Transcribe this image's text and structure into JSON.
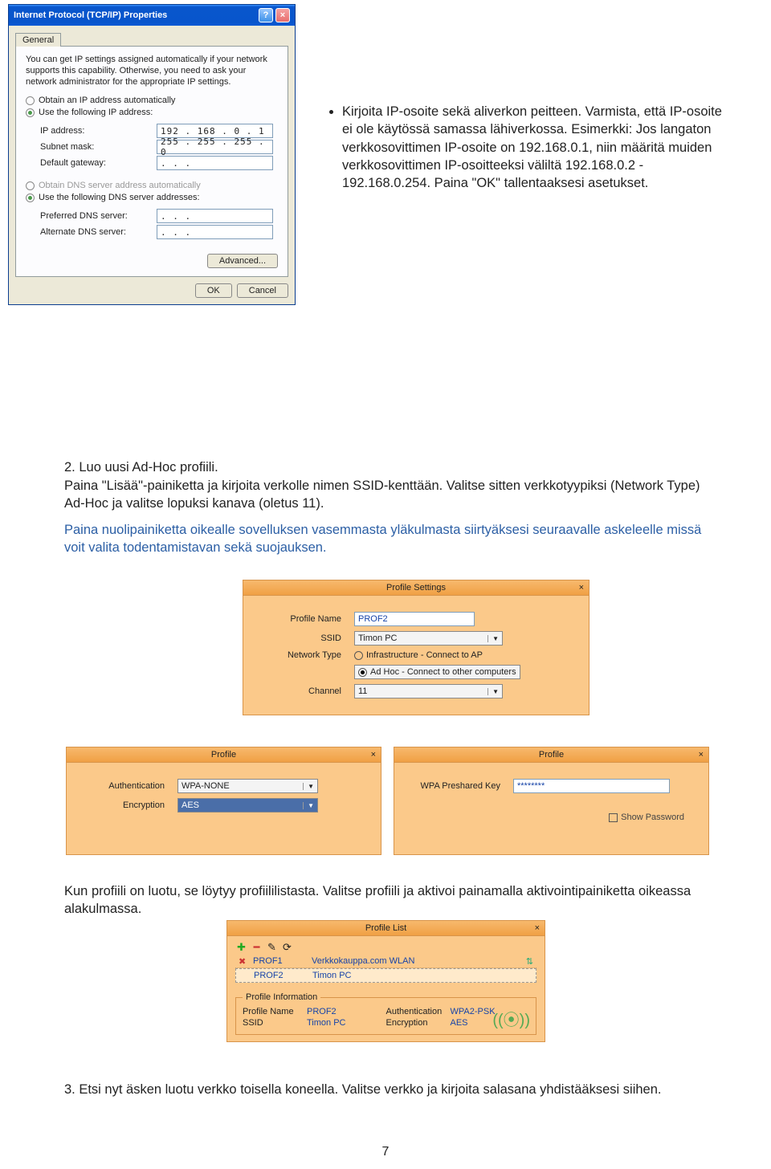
{
  "tcpip": {
    "title": "Internet Protocol (TCP/IP) Properties",
    "tab": "General",
    "intro": "You can get IP settings assigned automatically if your network supports this capability. Otherwise, you need to ask your network administrator for the appropriate IP settings.",
    "opt_auto_ip": "Obtain an IP address automatically",
    "opt_use_ip": "Use the following IP address:",
    "ip_label": "IP address:",
    "ip_value": "192 . 168 .   0 .   1",
    "subnet_label": "Subnet mask:",
    "subnet_value": "255 . 255 . 255 .   0",
    "gw_label": "Default gateway:",
    "gw_value": " .       .       .",
    "opt_auto_dns": "Obtain DNS server address automatically",
    "opt_use_dns": "Use the following DNS server addresses:",
    "pref_dns_label": "Preferred DNS server:",
    "alt_dns_label": "Alternate DNS server:",
    "empty_ip": " .       .       .",
    "advanced": "Advanced...",
    "ok": "OK",
    "cancel": "Cancel"
  },
  "bullets": {
    "b1": "Kirjoita IP-osoite sekä aliverkon peitteen. Varmista, että IP-osoite ei ole käytössä samassa lähiverkossa. Esimerkki: Jos langaton verkkosovittimen IP-osoite on 192.168.0.1, niin määritä muiden verkkosovittimen IP-osoitteeksi väliltä 192.168.0.2 - 192.168.0.254. Paina \"OK\" tallentaaksesi asetukset."
  },
  "s1": {
    "head": "2.   Luo uusi Ad-Hoc profiili.",
    "p1": "Paina \"Lisää\"-painiketta ja kirjoita verkolle nimen SSID-kenttään. Valitse sitten verkkotyypiksi (Network Type) Ad-Hoc ja valitse lopuksi kanava (oletus 11).",
    "p2": "Paina nuolipainiketta oikealle sovelluksen vasemmasta yläkulmasta siirtyäksesi seuraavalle askeleelle missä voit valita todentamistavan sekä suojauksen."
  },
  "profileSettings": {
    "title": "Profile Settings",
    "pn_label": "Profile Name",
    "pn_value": "PROF2",
    "ssid_label": "SSID",
    "ssid_value": "Timon PC",
    "nt_label": "Network Type",
    "nt_infra": "Infrastructure - Connect to AP",
    "nt_adhoc": "Ad Hoc - Connect to other computers",
    "ch_label": "Channel",
    "ch_value": "11"
  },
  "authPanel": {
    "title": "Profile",
    "auth_label": "Authentication",
    "auth_value": "WPA-NONE",
    "enc_label": "Encryption",
    "enc_value": "AES"
  },
  "keyPanel": {
    "title": "Profile",
    "key_label": "WPA Preshared Key",
    "key_value": "********",
    "show_pw": "Show Password"
  },
  "s2": "Kun profiili on luotu, se löytyy profiililistasta. Valitse profiili ja aktivoi painamalla aktivointipainiketta oikeassa alakulmassa.",
  "profileList": {
    "title": "Profile List",
    "rows": [
      {
        "name": "PROF1",
        "ssid": "Verkkokauppa.com WLAN"
      },
      {
        "name": "PROF2",
        "ssid": "Timon PC"
      }
    ],
    "legend": "Profile Information",
    "pn_k": "Profile Name",
    "pn_v": "PROF2",
    "ssid_k": "SSID",
    "ssid_v": "Timon PC",
    "auth_k": "Authentication",
    "auth_v": "WPA2-PSK",
    "enc_k": "Encryption",
    "enc_v": "AES"
  },
  "s3": "3.   Etsi nyt äsken luotu verkko toisella koneella. Valitse verkko ja kirjoita salasana yhdistääksesi siihen.",
  "page": "7"
}
